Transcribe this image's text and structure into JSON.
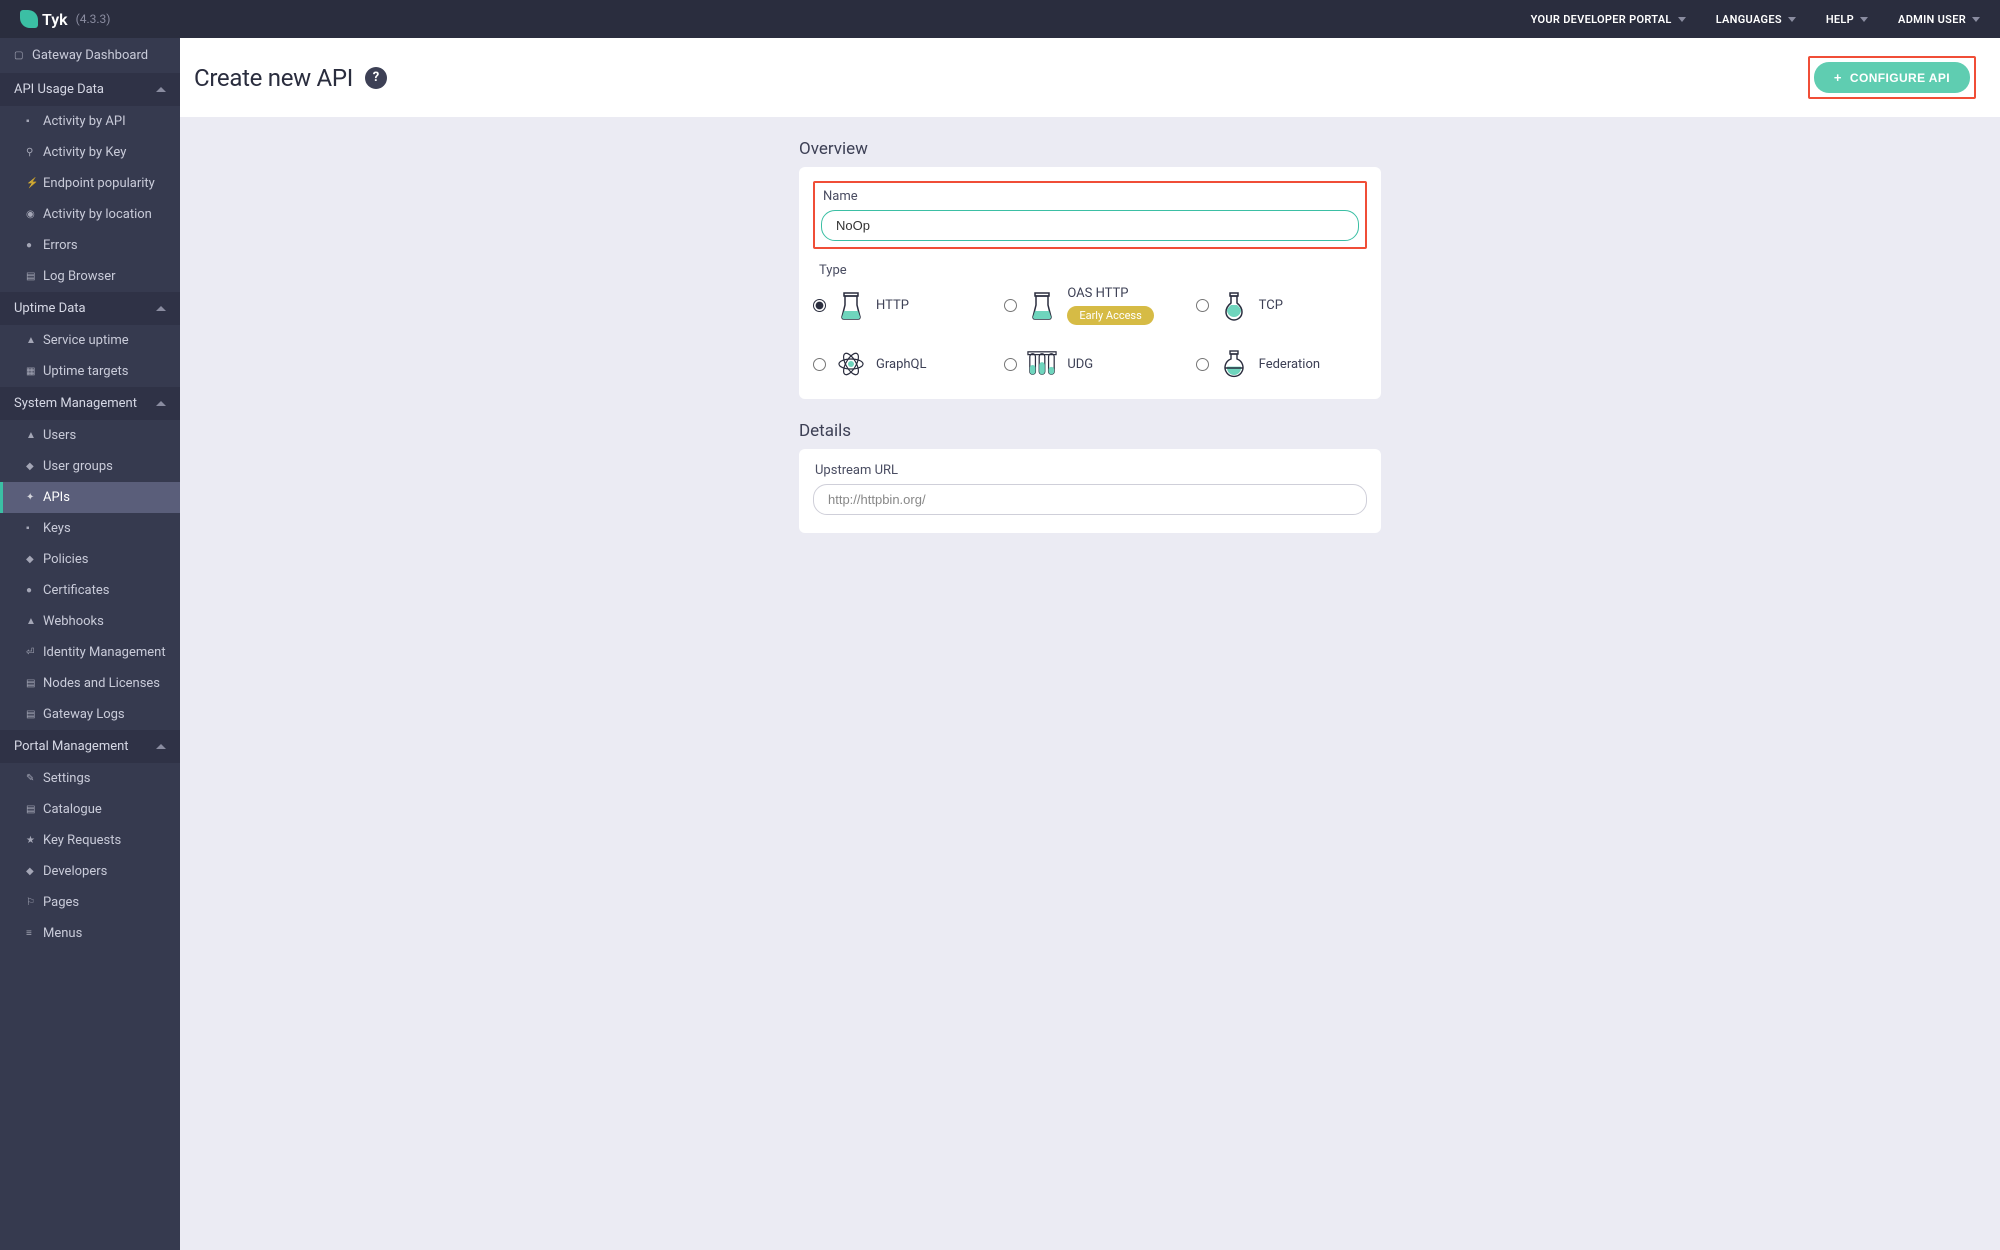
{
  "brand": {
    "name": "Tyk",
    "version": "(4.3.3)"
  },
  "header": {
    "links": [
      "YOUR DEVELOPER PORTAL",
      "LANGUAGES",
      "HELP",
      "ADMIN USER"
    ]
  },
  "sidebar": {
    "dashboard": "Gateway Dashboard",
    "sections": [
      {
        "title": "API Usage Data",
        "items": [
          "Activity by API",
          "Activity by Key",
          "Endpoint popularity",
          "Activity by location",
          "Errors",
          "Log Browser"
        ]
      },
      {
        "title": "Uptime Data",
        "items": [
          "Service uptime",
          "Uptime targets"
        ]
      },
      {
        "title": "System Management",
        "items": [
          "Users",
          "User groups",
          "APIs",
          "Keys",
          "Policies",
          "Certificates",
          "Webhooks",
          "Identity Management",
          "Nodes and Licenses",
          "Gateway Logs"
        ],
        "activeIndex": 2
      },
      {
        "title": "Portal Management",
        "items": [
          "Settings",
          "Catalogue",
          "Key Requests",
          "Developers",
          "Pages",
          "Menus"
        ]
      }
    ]
  },
  "page": {
    "title": "Create new API",
    "configure_label": "CONFIGURE API"
  },
  "overview": {
    "section_title": "Overview",
    "name_label": "Name",
    "name_value": "NoOp",
    "type_label": "Type",
    "types": [
      {
        "label": "HTTP",
        "selected": true
      },
      {
        "label": "OAS HTTP",
        "badge": "Early Access"
      },
      {
        "label": "TCP"
      },
      {
        "label": "GraphQL"
      },
      {
        "label": "UDG"
      },
      {
        "label": "Federation"
      }
    ]
  },
  "details": {
    "section_title": "Details",
    "upstream_label": "Upstream URL",
    "upstream_placeholder": "http://httpbin.org/"
  }
}
